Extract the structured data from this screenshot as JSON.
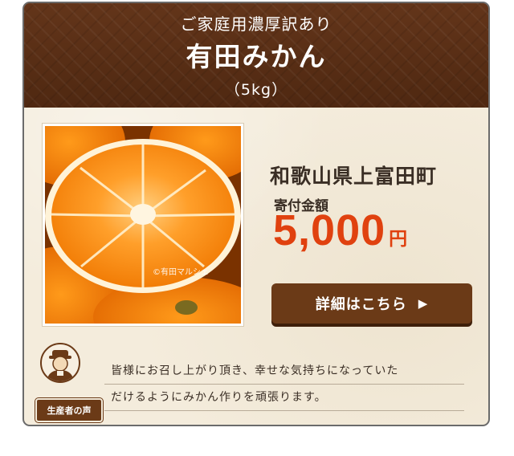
{
  "header": {
    "subtitle": "ご家庭用濃厚訳あり",
    "title": "有田みかん",
    "weight": "（5kg）"
  },
  "photo": {
    "watermark": "©有田マルシェ",
    "subject": "cut-mandarin-orange"
  },
  "product": {
    "town": "和歌山県上富田町",
    "price_label": "寄付金額",
    "price": "5,000",
    "currency": "円"
  },
  "detail_button": {
    "label": "詳細はこちら",
    "arrow": "▶"
  },
  "producer": {
    "badge": "生産者の声",
    "avatar_icon": "farmer-avatar-icon",
    "lines": [
      "皆様にお召し上がり頂き、幸せな気持ちになっていた",
      "だけるようにみかん作りを頑張ります。"
    ]
  },
  "colors": {
    "header_brown": "#5a2f14",
    "button_brown": "#6b3a17",
    "price_orange": "#e0410f",
    "background_cream": "#f4ecdc"
  }
}
